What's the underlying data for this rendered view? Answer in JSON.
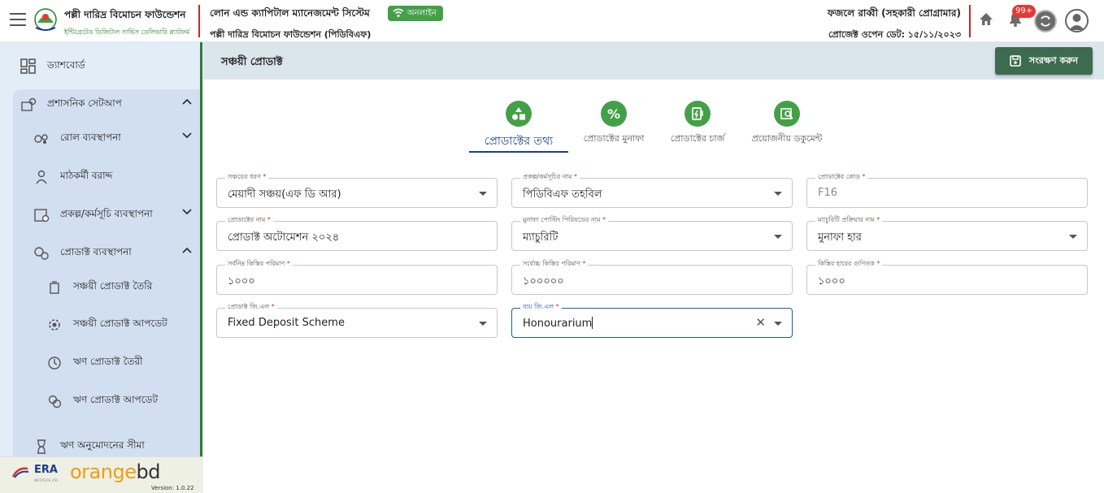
{
  "header": {
    "org_name": "পল্লী দারিদ্র বিমোচন ফাউন্ডেশন",
    "org_tagline": "ইন্টিগ্রেটেড ডিজিটাল সার্ভিস ডেলিভারি প্ল্যাটফর্ম",
    "system_name": "লোন এন্ড ক্যাপিটাল ম্যানেজমেন্ট সিস্টেম",
    "system_org": "পল্লী দারিদ্র বিমোচন ফাউন্ডেশন (পিডিবিএফ)",
    "online_label": "অনলাইন",
    "user_name": "ফজলে রাব্বী (সহকারী প্রোগ্রামার)",
    "project_open_date": "প্রোজেক্ট ওপেন ডেট: ১৫/১১/২০২৩",
    "notification_count": "99+"
  },
  "sidebar": {
    "items": [
      {
        "label": "ড্যাশবোর্ড",
        "icon": "dashboard-icon"
      },
      {
        "label": "প্রশাসনিক সেটআপ",
        "icon": "admin-setup-icon"
      },
      {
        "label": "রোল ব্যবস্থাপনা",
        "icon": "role-icon"
      },
      {
        "label": "মাঠকর্মী বরাদ্দ",
        "icon": "field-worker-icon"
      },
      {
        "label": "প্রকল্প/কর্মসূচি ব্যবস্থাপনা",
        "icon": "project-icon"
      },
      {
        "label": "প্রোডাক্ট ব্যবস্থাপনা",
        "icon": "product-icon"
      },
      {
        "label": "সঞ্চয়ী প্রোডাক্ট তৈরি",
        "icon": "savings-create-icon"
      },
      {
        "label": "সঞ্চয়ী প্রোডাক্ট আপডেট",
        "icon": "savings-update-icon"
      },
      {
        "label": "ঋণ প্রোডাক্ট তৈরী",
        "icon": "loan-create-icon"
      },
      {
        "label": "ঋণ প্রোডাক্ট আপডেট",
        "icon": "loan-update-icon"
      },
      {
        "label": "ঋণ অনুমোদনের সীমা",
        "icon": "loan-limit-icon"
      }
    ],
    "footer": {
      "era": "ERA",
      "era_sub": "INFOTECH LTD",
      "orange": "orange",
      "bd": "bd",
      "version": "Version: 1.0.22"
    }
  },
  "page": {
    "title": "সঞ্চয়ী প্রোডাক্ট",
    "save_label": "সংরক্ষণ করুন",
    "steps": [
      {
        "label": "প্রোডাক্টের তথ্য",
        "icon": "shapes-icon"
      },
      {
        "label": "প্রোডাক্টের মুনাফা",
        "icon": "percent-icon"
      },
      {
        "label": "প্রোডাক্টের চার্জ",
        "icon": "charge-icon"
      },
      {
        "label": "প্রয়োজনীয় ডকুমেন্ট",
        "icon": "document-search-icon"
      }
    ]
  },
  "form": {
    "savings_type": {
      "label": "সঞ্চয়ের ধরণ",
      "value": "মেয়াদী সঞ্চয়(এফ ডি আর)"
    },
    "project_name": {
      "label": "প্রকল্প/কর্মসূচির নাম",
      "value": "পিডিবিএফ তহবিল"
    },
    "product_code": {
      "label": "প্রোডাক্টের কোড",
      "value": "F16"
    },
    "product_name": {
      "label": "প্রোডাক্টের নাম",
      "value": "প্রোডাক্ট অটোমেশন ২০২৪"
    },
    "profit_posting": {
      "label": "মুনাফা পোস্টিং পিরিয়ডের নাম",
      "value": "ম্যাচুরিটি"
    },
    "maturity_process": {
      "label": "ম্যাচুরিটি প্রক্রিয়ার নাম",
      "value": "মুনাফা হার"
    },
    "min_installment": {
      "label": "সর্বনিম্ন কিস্তির পরিমাণ",
      "value": "১০০০"
    },
    "max_installment": {
      "label": "সর্বোচ্চ কিস্তির পরিমাণ",
      "value": "১০০০০০"
    },
    "installment_multiplier": {
      "label": "কিস্তির হারের গুণিতক",
      "value": "১০০০"
    },
    "product_gl": {
      "label": "প্রোডাক্ট জি.এল",
      "value": "Fixed Deposit Scheme"
    },
    "expense_gl": {
      "label": "ব্যয় জি.এল",
      "value": "Honourarium"
    }
  }
}
